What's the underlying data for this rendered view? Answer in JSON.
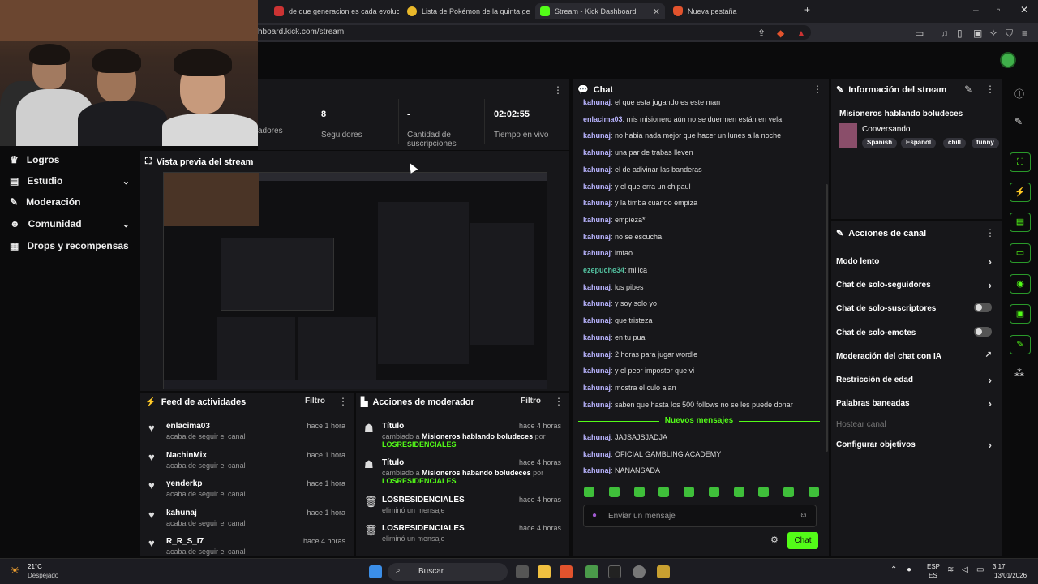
{
  "browser": {
    "tabs": [
      {
        "label": "de que generacion es cada evolucion"
      },
      {
        "label": "Lista de Pokémon de la quinta gener"
      },
      {
        "label": "Stream - Kick Dashboard"
      },
      {
        "label": "Nueva pestaña"
      }
    ],
    "url": "hboard.kick.com/stream"
  },
  "stats": {
    "followers_value": "8",
    "followers_label": "Seguidores",
    "subs_value": "-",
    "subs_label_1": "Cantidad de",
    "subs_label_2": "suscripciones",
    "time_value": "02:02:55",
    "time_label": "Tiempo en vivo",
    "viewers_label": "adores"
  },
  "sidebar": {
    "items": [
      {
        "label": "Logros"
      },
      {
        "label": "Estudio"
      },
      {
        "label": "Moderación"
      },
      {
        "label": "Comunidad"
      },
      {
        "label": "Drops y recompensas"
      }
    ]
  },
  "preview": {
    "title": "Vista previa del stream"
  },
  "feed": {
    "title": "Feed de actividades",
    "filter": "Filtro",
    "items": [
      {
        "name": "enlacima03",
        "sub": "acaba de seguir el canal",
        "time": "hace 1 hora"
      },
      {
        "name": "NachinMix",
        "sub": "acaba de seguir el canal",
        "time": "hace 1 hora"
      },
      {
        "name": "yenderkp",
        "sub": "acaba de seguir el canal",
        "time": "hace 1 hora"
      },
      {
        "name": "kahunaj",
        "sub": "acaba de seguir el canal",
        "time": "hace 1 hora"
      },
      {
        "name": "R_R_S_I7",
        "sub": "acaba de seguir el canal",
        "time": "hace 4 horas"
      }
    ]
  },
  "mods": {
    "title": "Acciones de moderador",
    "filter": "Filtro",
    "items": [
      {
        "name": "Título",
        "pre": "cambiado a",
        "bold": "Misioneros hablando boludeces",
        "post": "por",
        "who": "LOSRESIDENCIALES",
        "time": "hace 4 horas"
      },
      {
        "name": "Título",
        "pre": "cambiado a",
        "bold": "Misioneros habando boludeces",
        "post": "por",
        "who": "LOSRESIDENCIALES",
        "time": "hace 4 horas"
      },
      {
        "name": "LOSRESIDENCIALES",
        "pre": "eliminó un mensaje",
        "bold": "",
        "post": "",
        "who": "",
        "time": "hace 4 horas"
      },
      {
        "name": "LOSRESIDENCIALES",
        "pre": "eliminó un mensaje",
        "bold": "",
        "post": "",
        "who": "",
        "time": "hace 4 horas"
      }
    ]
  },
  "chat": {
    "title": "Chat",
    "messages": [
      {
        "user": "kahunaj",
        "text": "el que esta jugando es este man"
      },
      {
        "user": "enlacima03",
        "text": "mis misionero aún no se duermen están en vela"
      },
      {
        "user": "kahunaj",
        "text": "no habia nada mejor que hacer un lunes a la noche"
      },
      {
        "user": "kahunaj",
        "text": "una par de trabas lleven"
      },
      {
        "user": "kahunaj",
        "text": "el de adivinar las banderas"
      },
      {
        "user": "kahunaj",
        "text": "y el que erra un chipaul"
      },
      {
        "user": "kahunaj",
        "text": "y la timba cuando empiza"
      },
      {
        "user": "kahunaj",
        "text": "empieza*"
      },
      {
        "user": "kahunaj",
        "text": "no se escucha"
      },
      {
        "user": "kahunaj",
        "text": "lmfao"
      },
      {
        "user": "ezepuche34",
        "text": "milica"
      },
      {
        "user": "kahunaj",
        "text": "los pibes"
      },
      {
        "user": "kahunaj",
        "text": "y soy solo yo"
      },
      {
        "user": "kahunaj",
        "text": "que tristeza"
      },
      {
        "user": "kahunaj",
        "text": "en tu pua"
      },
      {
        "user": "kahunaj",
        "text": "2 horas para jugar wordle"
      },
      {
        "user": "kahunaj",
        "text": "y el peor impostor que vi"
      },
      {
        "user": "kahunaj",
        "text": "mostra el culo alan"
      },
      {
        "user": "kahunaj",
        "text": "saben que hasta los 500 follows no se les puede donar"
      }
    ],
    "new_label": "Nuevos mensajes",
    "new_messages": [
      {
        "user": "kahunaj",
        "text": "JAJSAJSJADJA"
      },
      {
        "user": "kahunaj",
        "text": "OFICIAL GAMBLING ACADEMY"
      },
      {
        "user": "kahunaj",
        "text": "NANANSADA"
      }
    ],
    "input_placeholder": "Enviar un mensaje",
    "send_label": "Chat"
  },
  "info": {
    "title": "Información del stream",
    "stream_title": "Misioneros hablando boludeces",
    "category": "Conversando",
    "tags": [
      "Spanish",
      "Español",
      "chill",
      "funny"
    ]
  },
  "actions": {
    "title": "Acciones de canal",
    "items": [
      {
        "label": "Modo lento"
      },
      {
        "label": "Chat de solo-seguidores"
      },
      {
        "label": "Chat de solo-suscriptores"
      },
      {
        "label": "Chat de solo-emotes"
      },
      {
        "label": "Moderación del chat con IA"
      },
      {
        "label": "Restricción de edad"
      },
      {
        "label": "Palabras baneadas"
      },
      {
        "label": "Hostear canal"
      },
      {
        "label": "Configurar objetivos"
      }
    ]
  },
  "taskbar": {
    "temp": "21°C",
    "weather": "Despejado",
    "search": "Buscar",
    "lang1": "ESP",
    "lang2": "ES",
    "time": "3:17",
    "date": "13/01/2026"
  },
  "colors": {
    "accent": "#53fc18",
    "panel": "#17171a",
    "bg": "#0b0b0c"
  }
}
